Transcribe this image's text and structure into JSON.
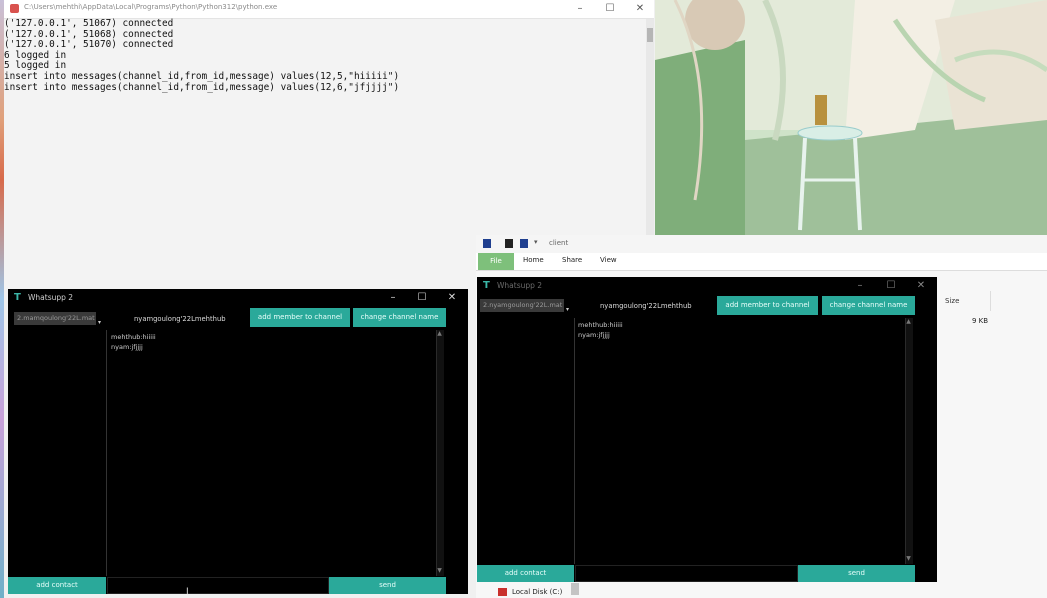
{
  "console": {
    "title": "C:\\Users\\mehthi\\AppData\\Local\\Programs\\Python\\Python312\\python.exe",
    "output": "('127.0.0.1', 51067) connected\n('127.0.0.1', 51068) connected\n('127.0.0.1', 51070) connected\n6 logged in\n5 logged in\ninsert into messages(channel_id,from_id,message) values(12,5,\"hiiiii\")\ninsert into messages(channel_id,from_id,message) values(12,6,\"jfjjjj\")",
    "controls": [
      "–",
      "☐",
      "✕"
    ]
  },
  "explorer": {
    "title": "client",
    "tabs": [
      "File",
      "Home",
      "Share",
      "View"
    ],
    "column_size": "Size",
    "size_value": "9 KB",
    "local_disk": "Local Disk (C:)"
  },
  "chat_left": {
    "title": "Whatsupp 2",
    "controls": [
      "–",
      "☐",
      "✕"
    ],
    "user_select": "2.mamqoulong'22L.mat",
    "channel_name": "nyamgoulong'22Lmehthub",
    "add_member_label": "add member to channel",
    "change_channel_label": "change channel name",
    "messages": [
      "mehthub:hiiiii",
      "nyam:jfjjjj"
    ],
    "add_contact_label": "add contact",
    "send_label": "send"
  },
  "chat_right": {
    "title": "Whatsupp 2",
    "controls": [
      "–",
      "☐",
      "✕"
    ],
    "user_select": "2.nyamgoulong'22L.mat",
    "channel_name": "nyamgoulong'22Lmehthub",
    "add_member_label": "add member to channel",
    "change_channel_label": "change channel name",
    "messages": [
      "mehthub:hiiiii",
      "nyam:jfjjjj"
    ],
    "add_contact_label": "add contact",
    "send_label": "send"
  },
  "colors": {
    "accent_teal": "#2aa99a",
    "chat_background": "#000000",
    "ribbon_file": "#7ec07b"
  }
}
